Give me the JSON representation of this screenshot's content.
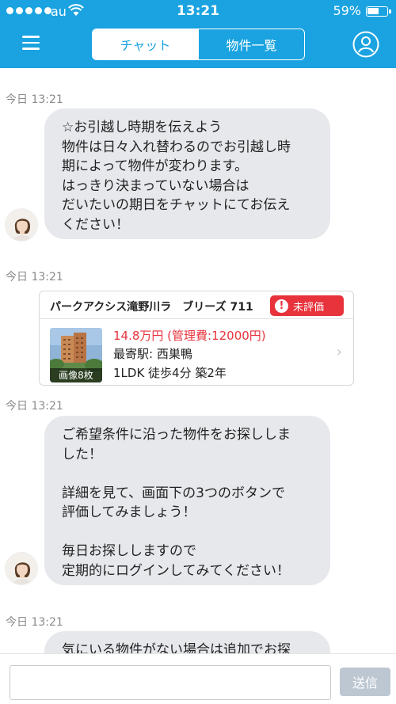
{
  "status_bar": {
    "carrier": "au",
    "time": "13:21",
    "battery": "59%",
    "battery_level": 0.59
  },
  "header": {
    "tabs": [
      {
        "label": "チャット",
        "active": true
      },
      {
        "label": "物件一覧",
        "active": false
      }
    ],
    "accent_color": "#1aa3e0"
  },
  "messages": [
    {
      "timestamp": "今日 13:21",
      "lines": [
        "☆お引越し時期を伝えよう",
        "物件は日々入れ替わるのでお引越し時",
        "期によって物件が変わります。",
        "はっきり決まっていない場合は",
        "だいたいの期日をチャットにてお伝え",
        "ください！"
      ]
    },
    {
      "timestamp": "今日 13:21",
      "property": {
        "name": "パークアクシス滝野川ラ　ブリーズ 711",
        "badge": "未評価",
        "photo_label": "画像8枚",
        "price": "14.8万円 (管理費:12000円)",
        "station": "最寄駅:  西巣鴨",
        "specs": "1LDK  徒歩4分  築2年"
      }
    },
    {
      "timestamp": "今日 13:21",
      "lines": [
        "ご希望条件に沿った物件をお探ししま",
        "した！",
        "",
        "詳細を見て、画面下の3つのボタンで",
        "評価してみましょう！",
        "",
        "毎日お探ししますので",
        "定期的にログインしてみてください！"
      ]
    },
    {
      "timestamp": "今日 13:21",
      "lines": [
        "気にいる物件がない場合は追加でお探"
      ]
    }
  ],
  "input": {
    "value": "",
    "placeholder": "",
    "send_label": "送信"
  },
  "icons": [
    "menu-icon",
    "profile-icon",
    "wifi-icon",
    "alert-icon",
    "chevron-right-icon"
  ]
}
